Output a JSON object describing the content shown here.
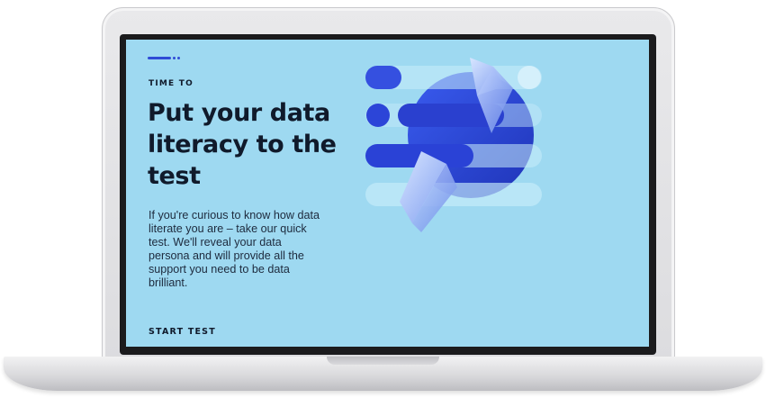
{
  "hero": {
    "eyebrow": "TIME TO",
    "headline": "Put your data literacy to the test",
    "body": "If you're curious to know how data literate you are – take our quick test. We'll reveal your data persona and will provide all the support you need to be data brilliant.",
    "cta_label": "START TEST"
  },
  "colors": {
    "screen_background": "#9ed9f1",
    "accent_blue": "#2f4bd6",
    "text_dark": "#101a2b"
  },
  "icons": {
    "illustration": "data-literacy-graphic-icon"
  }
}
